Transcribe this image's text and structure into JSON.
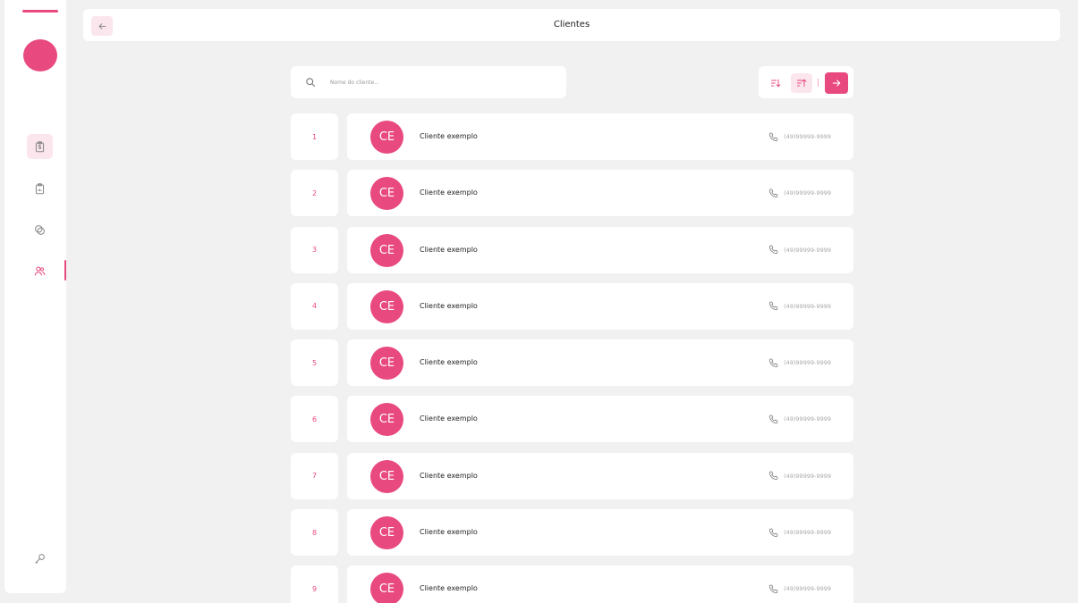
{
  "colors": {
    "accent": "#e8497f",
    "accent_light": "#fbe6ee",
    "background": "#f1f1f1",
    "card": "#ffffff"
  },
  "sidebar": {
    "items": [
      {
        "name": "orders",
        "icon": "clipboard-dollar-icon",
        "active_bg": true
      },
      {
        "name": "reports",
        "icon": "clipboard-icon",
        "active_bg": false
      },
      {
        "name": "products",
        "icon": "tags-icon",
        "active_bg": false
      },
      {
        "name": "clients",
        "icon": "users-icon",
        "active": true
      }
    ],
    "bottom_icon": "key-icon"
  },
  "header": {
    "title": "Clientes",
    "back_icon": "arrow-left-icon"
  },
  "search": {
    "placeholder": "Nome do cliente...",
    "value": "",
    "icon": "search-icon"
  },
  "sortbar": {
    "asc_icon": "sort-ascending-icon",
    "desc_icon": "sort-descending-icon",
    "go_icon": "arrow-right-icon"
  },
  "clients": [
    {
      "index": "1",
      "initials": "CE",
      "name": "Cliente exemplo",
      "phone": "(49)99999-9999"
    },
    {
      "index": "2",
      "initials": "CE",
      "name": "Cliente exemplo",
      "phone": "(49)99999-9999"
    },
    {
      "index": "3",
      "initials": "CE",
      "name": "Cliente exemplo",
      "phone": "(49)99999-9999"
    },
    {
      "index": "4",
      "initials": "CE",
      "name": "Cliente exemplo",
      "phone": "(49)99999-9999"
    },
    {
      "index": "5",
      "initials": "CE",
      "name": "Cliente exemplo",
      "phone": "(49)99999-9999"
    },
    {
      "index": "6",
      "initials": "CE",
      "name": "Cliente exemplo",
      "phone": "(49)99999-9999"
    },
    {
      "index": "7",
      "initials": "CE",
      "name": "Cliente exemplo",
      "phone": "(49)99999-9999"
    },
    {
      "index": "8",
      "initials": "CE",
      "name": "Cliente exemplo",
      "phone": "(49)99999-9999"
    },
    {
      "index": "9",
      "initials": "CE",
      "name": "Cliente exemplo",
      "phone": "(49)99999-9999"
    }
  ]
}
